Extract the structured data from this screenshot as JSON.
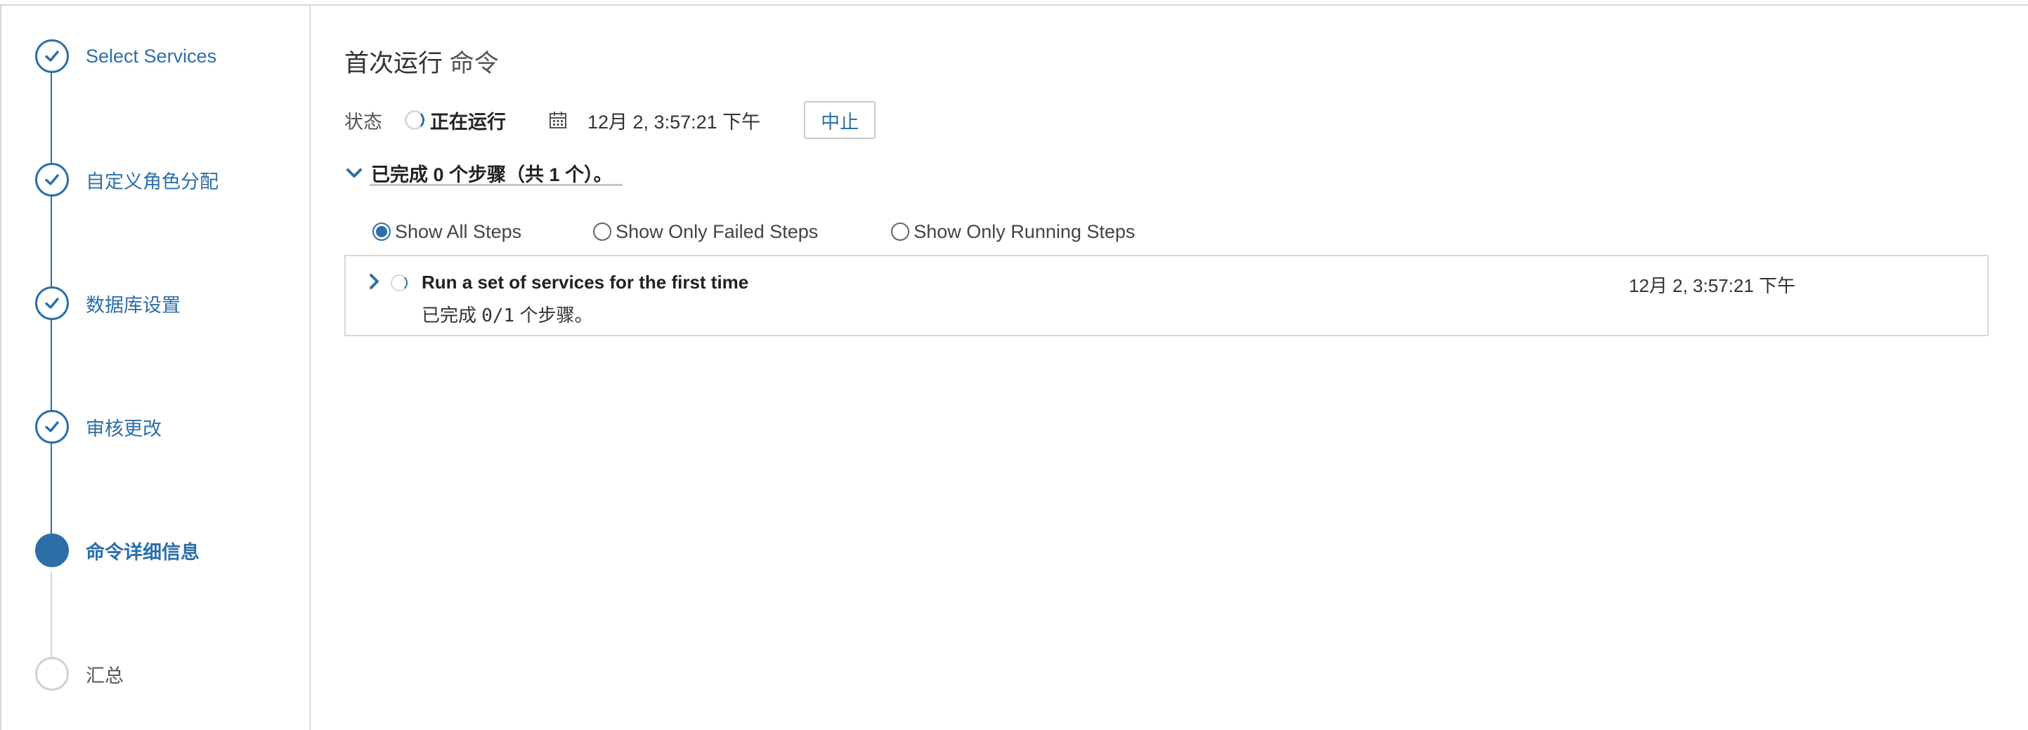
{
  "sidebar": {
    "steps": [
      {
        "label": "Select Services",
        "state": "done"
      },
      {
        "label": "自定义角色分配",
        "state": "done"
      },
      {
        "label": "数据库设置",
        "state": "done"
      },
      {
        "label": "审核更改",
        "state": "done"
      },
      {
        "label": "命令详细信息",
        "state": "active"
      },
      {
        "label": "汇总",
        "state": "pending"
      }
    ]
  },
  "main": {
    "title_main": "首次运行",
    "title_suffix": "命令",
    "status_label": "状态",
    "status_value": "正在运行",
    "start_time": "12月 2, 3:57:21 下午",
    "abort_label": "中止",
    "summary": "已完成 0 个步骤（共 1 个）。",
    "filters": [
      {
        "label": "Show All Steps",
        "checked": true
      },
      {
        "label": "Show Only Failed Steps",
        "checked": false
      },
      {
        "label": "Show Only Running Steps",
        "checked": false
      }
    ],
    "steps": [
      {
        "title": "Run a set of services for the first time",
        "time": "12月 2, 3:57:21 下午",
        "progress_prefix": "已完成",
        "progress_count": "0/1",
        "progress_suffix": "个步骤。"
      }
    ]
  },
  "colors": {
    "accent": "#2c6fa8",
    "pending": "#d0d0d0",
    "border": "#d9d9d9"
  },
  "icons": {
    "done": "check-icon",
    "calendar": "calendar-icon",
    "spinner": "spinner-icon",
    "expand": "chevron-down-icon",
    "collapse": "chevron-right-icon"
  }
}
